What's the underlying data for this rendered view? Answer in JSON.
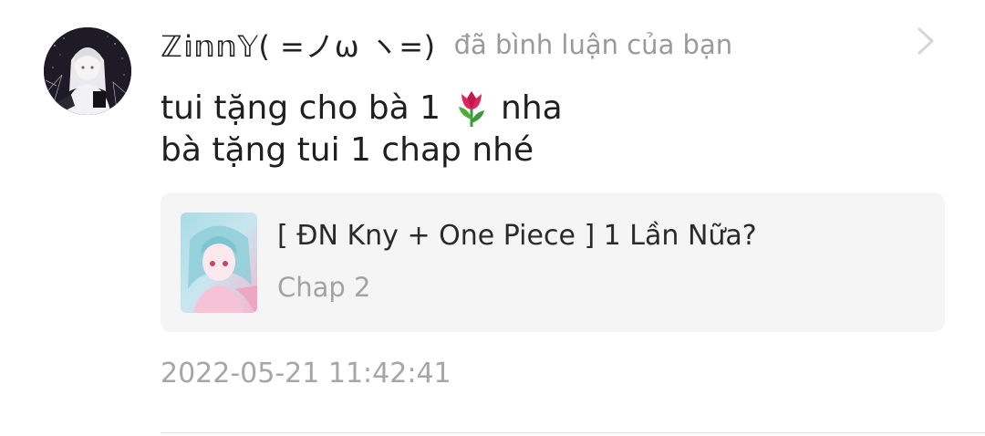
{
  "notification": {
    "user": {
      "name": "ℤ𝕚𝕟𝕟𝕐( =ノω ヽ=)",
      "avatar": "user-avatar-anime"
    },
    "action": "đã bình luận của bạn",
    "comment": {
      "line1_before": "tui tặng cho bà 1",
      "line1_emoji": "tulip-emoji",
      "line1_after": "nha",
      "line2": "bà tặng tui 1 chap nhé"
    },
    "story": {
      "title": "[ ĐN Kny + One Piece ] 1 Lần Nữa?",
      "chapter": "Chap 2",
      "cover": "story-cover-anime"
    },
    "timestamp": "2022-05-21 11:42:41"
  },
  "colors": {
    "text_primary": "#222222",
    "text_secondary": "#9a9a9a",
    "card_background": "#f5f5f5",
    "divider": "#e2e2e2"
  },
  "icons": {
    "chevron": "chevron-right-icon"
  }
}
